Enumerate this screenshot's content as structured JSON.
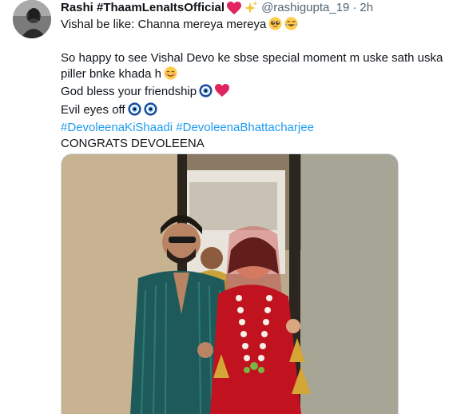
{
  "tweet": {
    "author_name": "Rashi #ThaamLenaItsOfficial",
    "handle": "@rashigupta_19",
    "separator": "·",
    "time": "2h",
    "lines": {
      "l1": "Vishal be like: Channa mereya mereya",
      "l2": "So happy to see Vishal Devo ke sbse special moment m uske sath uska",
      "l3": "piller bnke khada h",
      "l4": "God bless your friendship",
      "l5": "Evil eyes off",
      "hashtag1": "#DevoleenaKiShaadi",
      "hashtag2": "#DevoleenaBhattacharjee",
      "l7": "CONGRATS DEVOLEENA"
    },
    "icons": {
      "name_badges": [
        "red-heart-icon",
        "sparkles-icon"
      ],
      "line1": [
        "pleading-face-icon",
        "tears-of-joy-icon"
      ],
      "line3": [
        "smiling-face-icon"
      ],
      "line4": [
        "nazar-amulet-icon",
        "red-heart-icon"
      ],
      "line5": [
        "nazar-amulet-icon",
        "nazar-amulet-icon"
      ]
    },
    "colors": {
      "hashtag": "#1d9bf0",
      "secondary_text": "#536471",
      "heart": "#e0245e"
    }
  }
}
